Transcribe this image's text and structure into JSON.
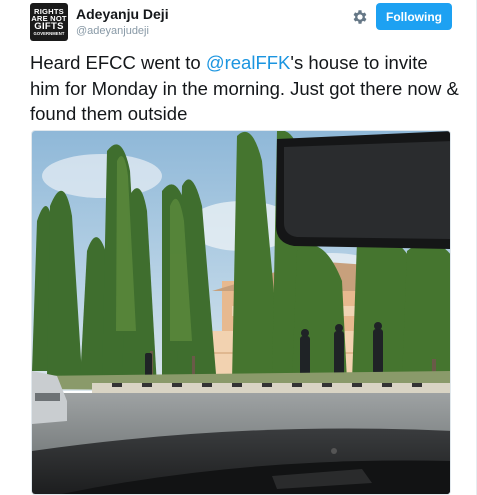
{
  "user": {
    "name": "Adeyanju Deji",
    "handle": "@adeyanjudeji",
    "avatar_lines": [
      "RIGHTS",
      "ARE NOT",
      "GIFTS",
      "GOVERNMENT"
    ]
  },
  "actions": {
    "settings_icon": "gear-icon",
    "follow_label": "Following"
  },
  "tweet": {
    "text_before": "Heard EFCC went to ",
    "mention": "@realFFK",
    "text_after": "'s house to invite him for Monday in the morning. Just got there now & found them outside"
  },
  "photo": {
    "subject": "tweet-photo"
  },
  "colors": {
    "accent": "#1da1f2",
    "mention": "#1b95e0",
    "text": "#14171a",
    "muted": "#8899a6"
  }
}
